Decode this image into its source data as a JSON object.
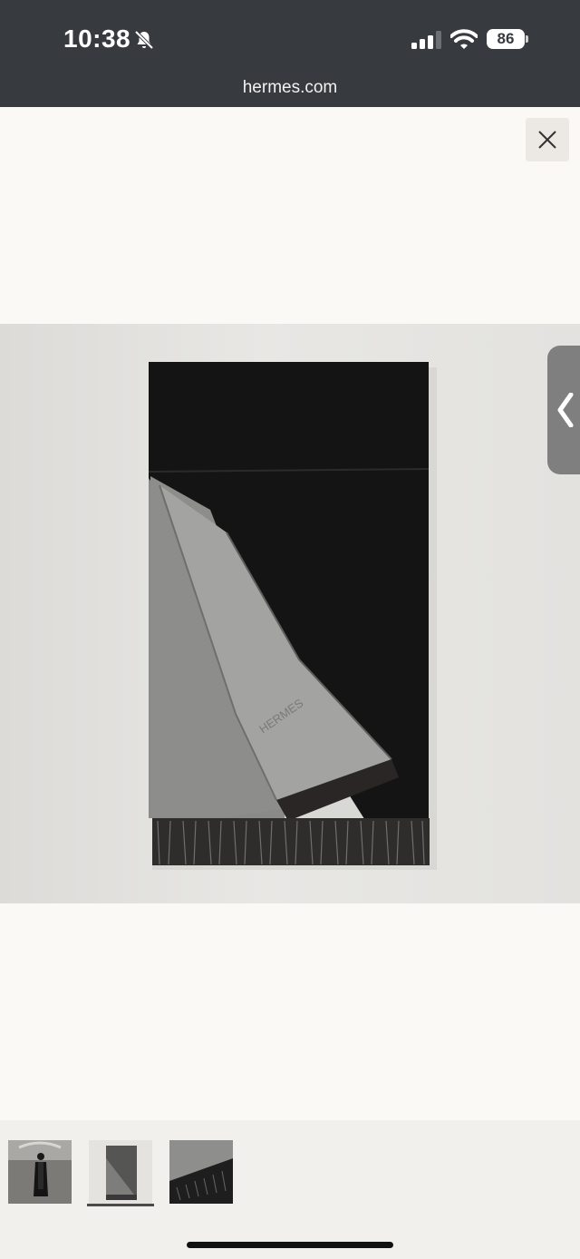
{
  "status_bar": {
    "time": "10:38",
    "battery": "86",
    "icons": [
      "bell-slash-icon",
      "signal-icon",
      "wifi-icon",
      "battery-icon"
    ]
  },
  "browser": {
    "url": "hermes.com"
  },
  "viewer": {
    "close_icon": "close-icon",
    "prev_icon": "chevron-left-icon",
    "main_image": "scarf-photo",
    "thumbnails": [
      "model-wearing-scarf",
      "scarf-folded",
      "scarf-fringe-detail"
    ],
    "selected_thumbnail": 2
  },
  "colors": {
    "status_bar": "#373a3f",
    "page_background": "#fbf9f5",
    "scarf_black": "#141414",
    "scarf_grey": "#8a8a88"
  }
}
